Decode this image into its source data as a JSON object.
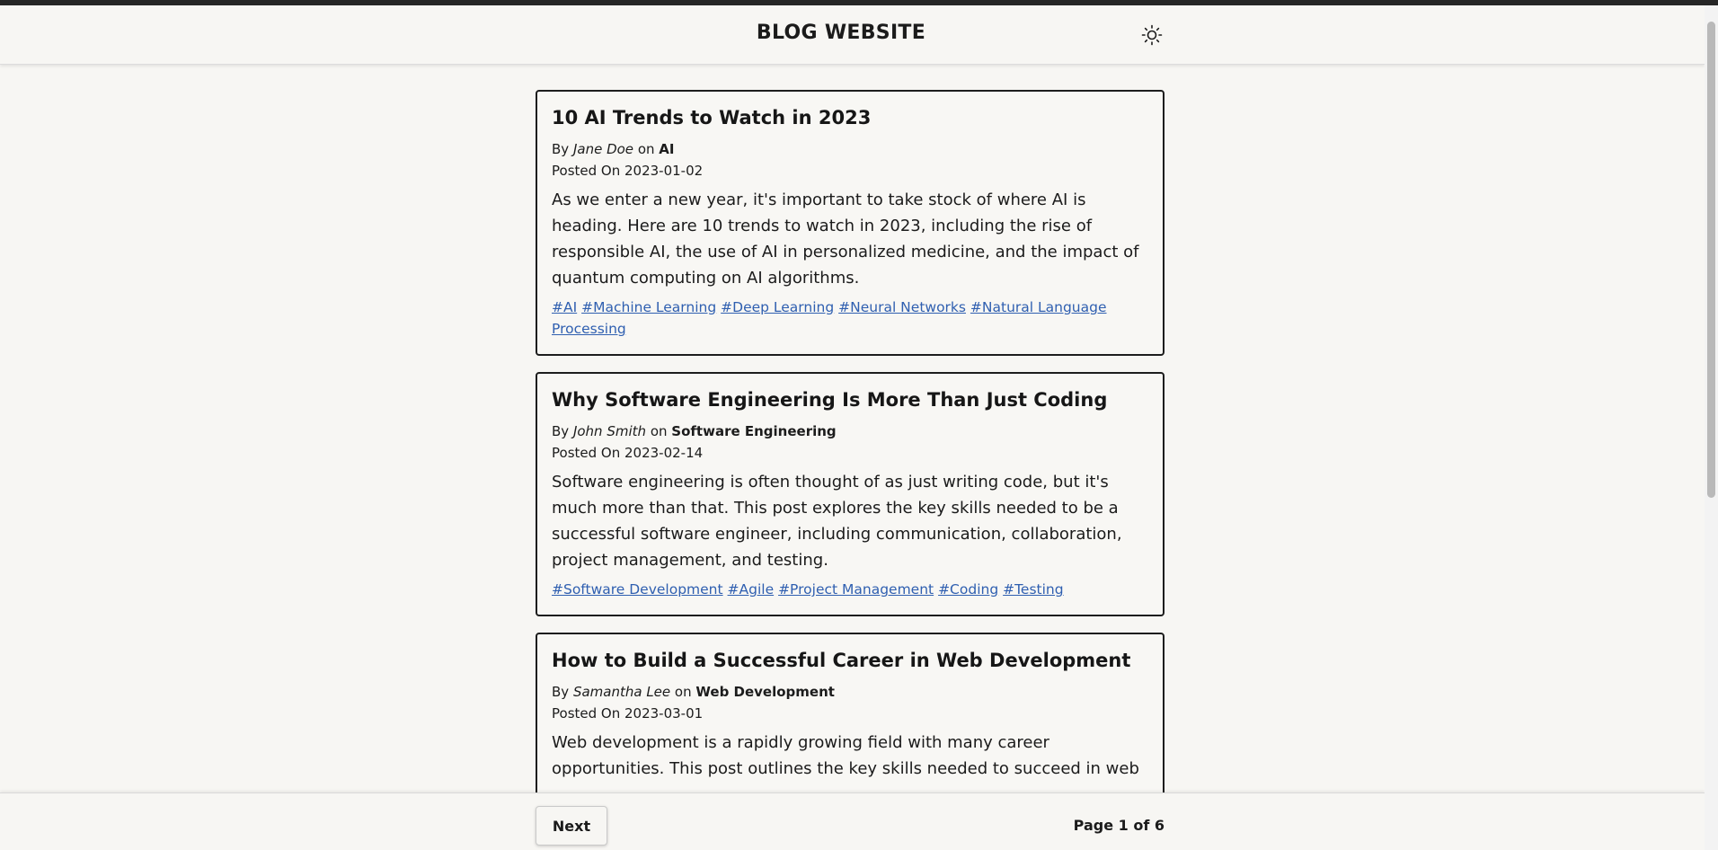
{
  "header": {
    "title": "BLOG WEBSITE",
    "theme_icon": "sun-icon"
  },
  "posts": [
    {
      "title": "10 AI Trends to Watch in 2023",
      "by_label": "By",
      "author": "Jane Doe",
      "on_label": "on",
      "category": "AI",
      "posted_label": "Posted On",
      "date": "2023-01-02",
      "excerpt": "As we enter a new year, it's important to take stock of where AI is heading. Here are 10 trends to watch in 2023, including the rise of responsible AI, the use of AI in personalized medicine, and the impact of quantum computing on AI algorithms.",
      "tags": [
        "#AI",
        "#Machine Learning",
        "#Deep Learning",
        "#Neural Networks",
        "#Natural Language Processing"
      ]
    },
    {
      "title": "Why Software Engineering Is More Than Just Coding",
      "by_label": "By",
      "author": "John Smith",
      "on_label": "on",
      "category": "Software Engineering",
      "posted_label": "Posted On",
      "date": "2023-02-14",
      "excerpt": "Software engineering is often thought of as just writing code, but it's much more than that. This post explores the key skills needed to be a successful software engineer, including communication, collaboration, project management, and testing.",
      "tags": [
        "#Software Development",
        "#Agile",
        "#Project Management",
        "#Coding",
        "#Testing"
      ]
    },
    {
      "title": "How to Build a Successful Career in Web Development",
      "by_label": "By",
      "author": "Samantha Lee",
      "on_label": "on",
      "category": "Web Development",
      "posted_label": "Posted On",
      "date": "2023-03-01",
      "excerpt": "Web development is a rapidly growing field with many career opportunities. This post outlines the key skills needed to succeed in web",
      "tags": []
    }
  ],
  "footer": {
    "next_label": "Next",
    "page_indicator": "Page 1 of 6"
  }
}
